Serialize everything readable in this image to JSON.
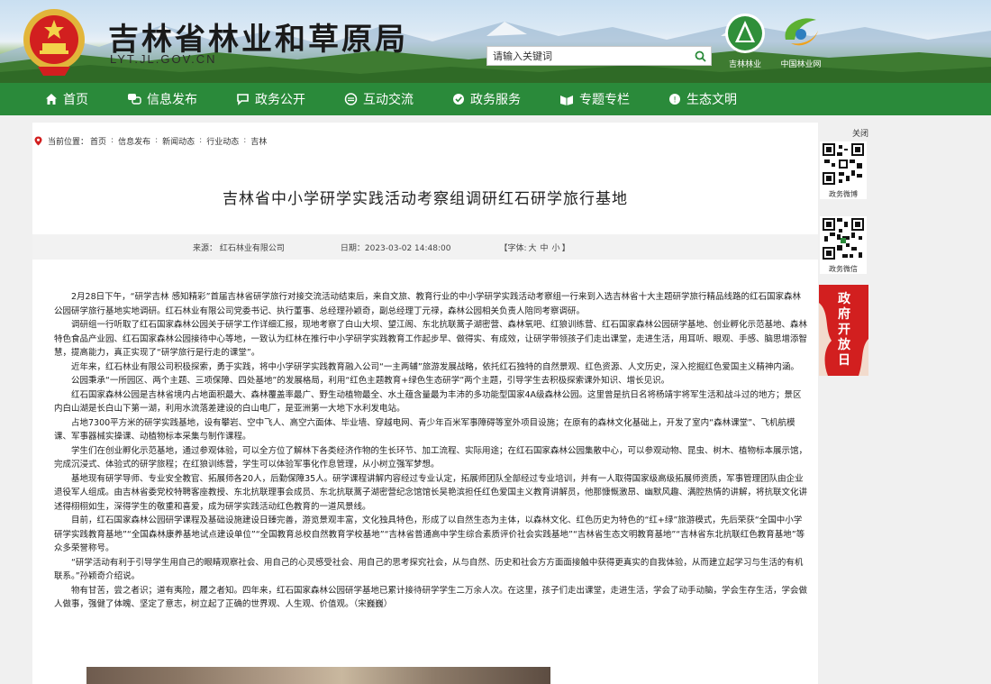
{
  "header": {
    "site_title": "吉林省林业和草原局",
    "site_domain": "LYT.JL.GOV.CN",
    "search_placeholder": "请输入关键词",
    "logo1_caption": "吉林林业",
    "logo2_caption": "中国林业网"
  },
  "nav": {
    "items": [
      {
        "label": "首页",
        "icon": "home-icon"
      },
      {
        "label": "信息发布",
        "icon": "chat-bubbles-icon"
      },
      {
        "label": "政务公开",
        "icon": "speech-bubble-icon"
      },
      {
        "label": "互动交流",
        "icon": "exchange-icon"
      },
      {
        "label": "政务服务",
        "icon": "service-icon"
      },
      {
        "label": "专题专栏",
        "icon": "column-icon"
      },
      {
        "label": "生态文明",
        "icon": "leaf-icon"
      }
    ]
  },
  "breadcrumb": {
    "prefix": "当前位置：",
    "items": [
      "首页",
      "信息发布",
      "新闻动态",
      "行业动态",
      "吉林"
    ]
  },
  "article": {
    "title": "吉林省中小学研学实践活动考察组调研红石研学旅行基地",
    "source": "来源： 红石林业有限公司",
    "date": "日期：2023-03-02 14:48:00",
    "font_prefix": "【字体:",
    "font_large": "大",
    "font_medium": "中",
    "font_small": "小",
    "font_suffix": "】",
    "paragraphs": [
      "2月28日下午，“研学吉林 感知精彩”首届吉林省研学旅行对接交流活动结束后，来自文旅、教育行业的中小学研学实践活动考察组一行来到入选吉林省十大主题研学旅行精品线路的红石国家森林公园研学旅行基地实地调研。红石林业有限公司党委书记、执行董事、总经理孙颖奇，副总经理丁元禄，森林公园相关负责人陪同考察调研。",
      "调研组一行听取了红石国家森林公园关于研学工作详细汇报，现地考察了白山大坝、望江阁、东北抗联蒿子湖密营、森林氧吧、红狼训练营、红石国家森林公园研学基地、创业孵化示范基地、森林特色食品产业园、红石国家森林公园接待中心等地，一致认为红林在推行中小学研学实践教育工作起步早、做得实、有成效，让研学带领孩子们走出课堂，走进生活，用耳听、眼观、手感、脑思增添智慧，提高能力，真正实现了“研学旅行是行走的课堂”。",
      "近年来，红石林业有限公司积极探索，勇于实践，将中小学研学实践教育融入公司“一主两辅”旅游发展战略，依托红石独特的自然景观、红色资源、人文历史，深入挖掘红色爱国主义精神内涵。",
      "公园秉承“一所园区、两个主题、三项保障、四处基地”的发展格局，利用“红色主题教育+绿色生态研学”两个主题，引导学生去积极探索课外知识、增长见识。",
      "红石国家森林公园是吉林省境内占地面积最大、森林覆盖率最广、野生动植物最全、水土蕴含量最为丰沛的多功能型国家4A级森林公园。这里曾是抗日名将杨靖宇将军生活和战斗过的地方；景区内白山湖是长白山下第一湖，利用水流落差建设的白山电厂，是亚洲第一大地下水利发电站。",
      "占地7300平方米的研学实践基地，设有攀岩、空中飞人、高空六面体、毕业墙、穿越电网、青少年百米军事障碍等室外项目设施；在原有的森林文化基础上，开发了室内“森林课堂”、飞机航模课、军事器械实操课、动植物标本采集与制作课程。",
      "学生们在创业孵化示范基地，通过参观体验，可以全方位了解林下各类经济作物的生长环节、加工流程、实际用途；在红石国家森林公园集散中心，可以参观动物、昆虫、树木、植物标本展示馆，完成沉浸式、体验式的研学旅程；在红狼训练营，学生可以体验军事化作息管理，从小树立强军梦想。",
      "基地现有研学导师、专业安全教官、拓展师各20人，后勤保障35人。研学课程讲解内容经过专业认定，拓展师团队全部经过专业培训，并有一人取得国家级高级拓展师资质，军事管理团队由企业退役军人组成。由吉林省委党校特聘客座教授、东北抗联理事会成员、东北抗联蒿子湖密营纪念馆馆长吴艳滨担任红色爱国主义教育讲解员，他那慷慨激昂、幽默风趣、满腔热情的讲解，将抗联文化讲述得栩栩如生，深得学生的敬重和喜爱，成为研学实践活动红色教育的一道风景线。",
      "目前，红石国家森林公园研学课程及基础设施建设日臻完善，游览景观丰富，文化独具特色，形成了以自然生态为主体，以森林文化、红色历史为特色的“红+绿”旅游模式，先后荣获“全国中小学研学实践教育基地”“全国森林康养基地试点建设单位”“全国教育总校自然教育学校基地”“吉林省普通高中学生综合素质评价社会实践基地”“吉林省生态文明教育基地”“吉林省东北抗联红色教育基地”等众多荣誉称号。",
      "“研学活动有利于引导学生用自己的眼睛观察社会、用自己的心灵感受社会、用自己的思考探究社会，从与自然、历史和社会方方面面接触中获得更真实的自我体验，从而建立起学习与生活的有机联系。”孙颖奇介绍说。",
      "物有甘苦，尝之者识；道有夷险，履之者知。四年来，红石国家森林公园研学基地已累计接待研学学生二万余人次。在这里，孩子们走出课堂，走进生活，学会了动手动脑，学会生存生活，学会做人做事，强健了体魄、坚定了意志，树立起了正确的世界观、人生观、价值观。（宋巍巍）"
    ]
  },
  "side": {
    "close_label": "关闭",
    "qr1_caption": "政务微博",
    "qr2_caption": "政务微信",
    "gov_open_text": "政府开放日"
  },
  "colors": {
    "nav_green": "#2a8a3a",
    "gov_open_red": "#d21f1f"
  }
}
